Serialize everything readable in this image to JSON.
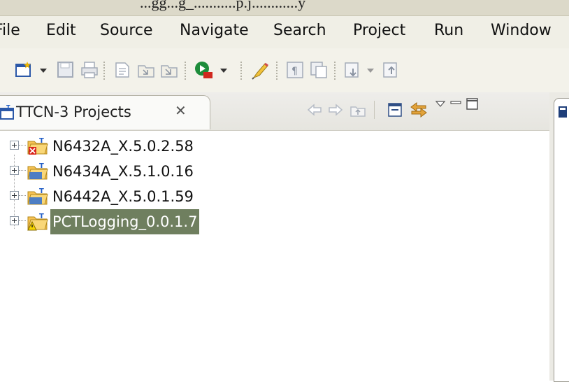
{
  "window": {
    "title": "...gg...g_...........p.j............y"
  },
  "menu": [
    "File",
    "Edit",
    "Source",
    "Navigate",
    "Search",
    "Project",
    "Run",
    "Window"
  ],
  "toolbar": {
    "icons": [
      "new-wizard-icon",
      "dropdown-arrow-icon",
      "save-icon",
      "print-icon",
      "open-type-icon",
      "open-resource-icon",
      "open-resource-alt-icon",
      "run-icon",
      "dropdown-arrow-icon",
      "highlight-icon",
      "show-whitespace-icon",
      "block-selection-icon",
      "next-annotation-icon",
      "dropdown-arrow-icon",
      "previous-annotation-icon"
    ]
  },
  "view": {
    "tab_title": "TTCN-3 Projects",
    "close_symbol": "✕"
  },
  "tree": {
    "projects": [
      {
        "label": "N6432A_X.5.0.2.58",
        "status": "error",
        "selected": false
      },
      {
        "label": "N6434A_X.5.1.0.16",
        "status": "ok",
        "selected": false
      },
      {
        "label": "N6442A_X.5.0.1.59",
        "status": "ok",
        "selected": false
      },
      {
        "label": "PCTLogging_0.0.1.7",
        "status": "warning",
        "selected": true
      }
    ]
  },
  "colors": {
    "selection": "#6f7f5f",
    "chrome": "#f0efe6",
    "accent_blue": "#1f5cc5"
  }
}
